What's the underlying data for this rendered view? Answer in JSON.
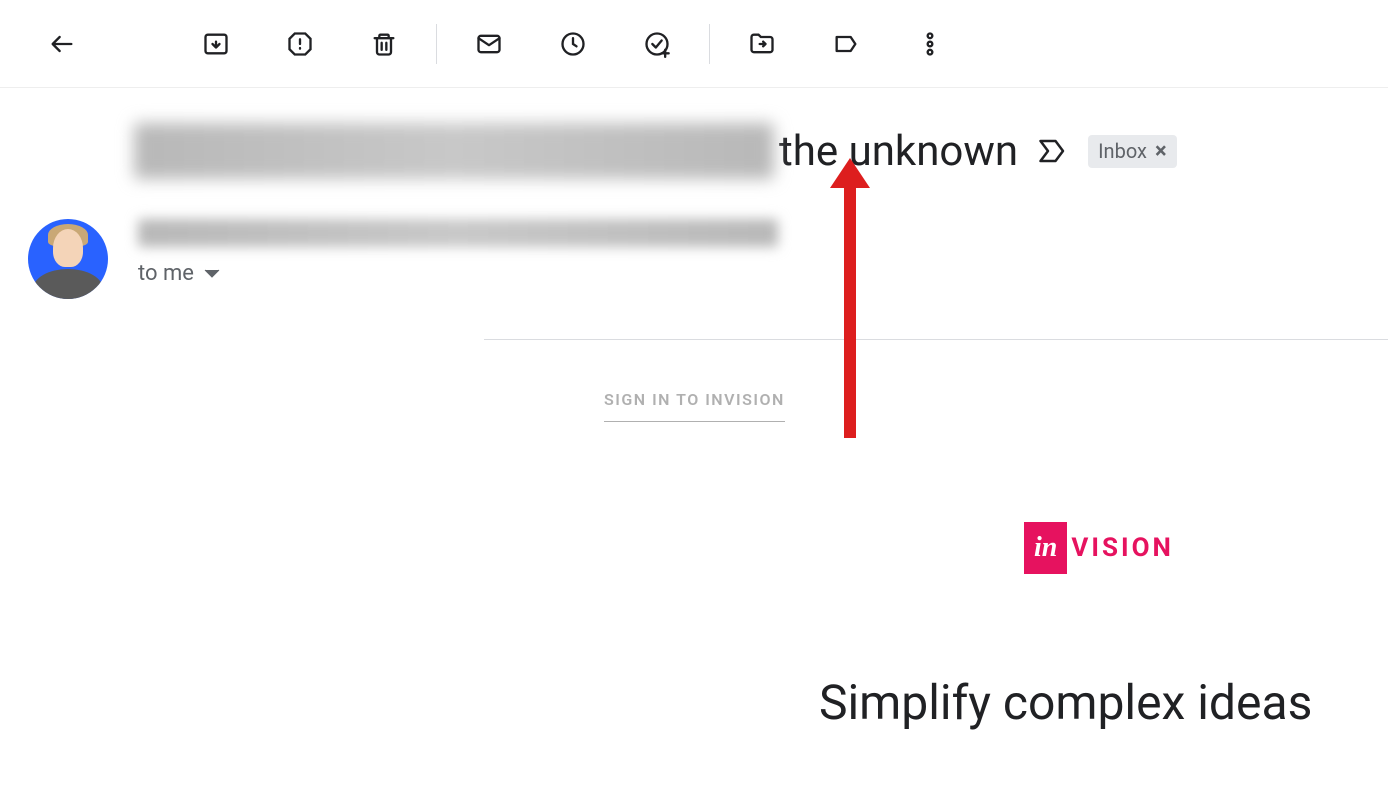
{
  "toolbar": {
    "icons": [
      "back",
      "archive",
      "spam",
      "delete",
      "mark-unread",
      "snooze",
      "add-to-tasks",
      "move-to",
      "labels",
      "more"
    ]
  },
  "subject": {
    "visible_part": "the unknown"
  },
  "labels": {
    "inbox": "Inbox"
  },
  "recipient": {
    "text": "to me"
  },
  "body": {
    "signin_text": "SIGN IN TO INVISION",
    "logo_in": "in",
    "logo_vision": "VISION",
    "heading": "Simplify complex ideas"
  },
  "annotation": {
    "arrow_color": "#dd1e1e"
  }
}
